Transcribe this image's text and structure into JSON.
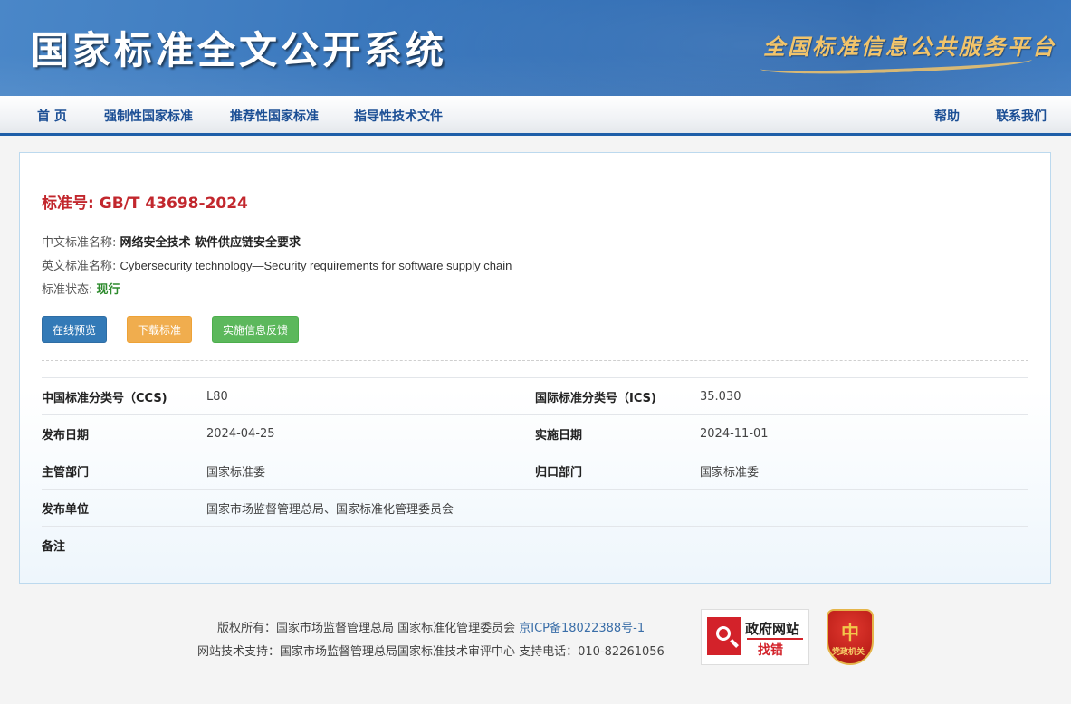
{
  "header": {
    "site_title": "国家标准全文公开系统",
    "slogan": "全国标准信息公共服务平台"
  },
  "nav": {
    "items": [
      "首 页",
      "强制性国家标准",
      "推荐性国家标准",
      "指导性技术文件"
    ],
    "right_items": [
      "帮助",
      "联系我们"
    ]
  },
  "standard": {
    "number_label": "标准号:",
    "number": "GB/T 43698-2024",
    "cn_name_label": "中文标准名称:",
    "cn_name": "网络安全技术 软件供应链安全要求",
    "en_name_label": "英文标准名称:",
    "en_name": "Cybersecurity technology—Security requirements for software supply chain",
    "status_label": "标准状态:",
    "status": "现行"
  },
  "buttons": {
    "preview": "在线预览",
    "download": "下载标准",
    "feedback": "实施信息反馈"
  },
  "info": {
    "ccs_label": "中国标准分类号（CCS)",
    "ccs": "L80",
    "ics_label": "国际标准分类号（ICS)",
    "ics": "35.030",
    "publish_date_label": "发布日期",
    "publish_date": "2024-04-25",
    "impl_date_label": "实施日期",
    "impl_date": "2024-11-01",
    "dept_label": "主管部门",
    "dept": "国家标准委",
    "owner_label": "归口部门",
    "owner": "国家标准委",
    "publisher_label": "发布单位",
    "publisher": "国家市场监督管理总局、国家标准化管理委员会",
    "remark_label": "备注",
    "remark": ""
  },
  "footer": {
    "copyright": "版权所有：国家市场监督管理总局 国家标准化管理委员会 ",
    "icp": "京ICP备18022388号-1",
    "support": "网站技术支持：国家市场监督管理总局国家标准技术审评中心 支持电话：010-82261056",
    "gov_badge_title": "政府网站",
    "gov_badge_sub": "找错",
    "party_badge_text": "党政机关"
  },
  "colors": {
    "header_blue": "#2f6db5",
    "nav_text": "#1c4f95",
    "std_red": "#c2272d",
    "status_green": "#2e8b2e",
    "btn_blue": "#337ab7",
    "btn_orange": "#f0ad4e",
    "btn_green": "#5cb85c"
  }
}
